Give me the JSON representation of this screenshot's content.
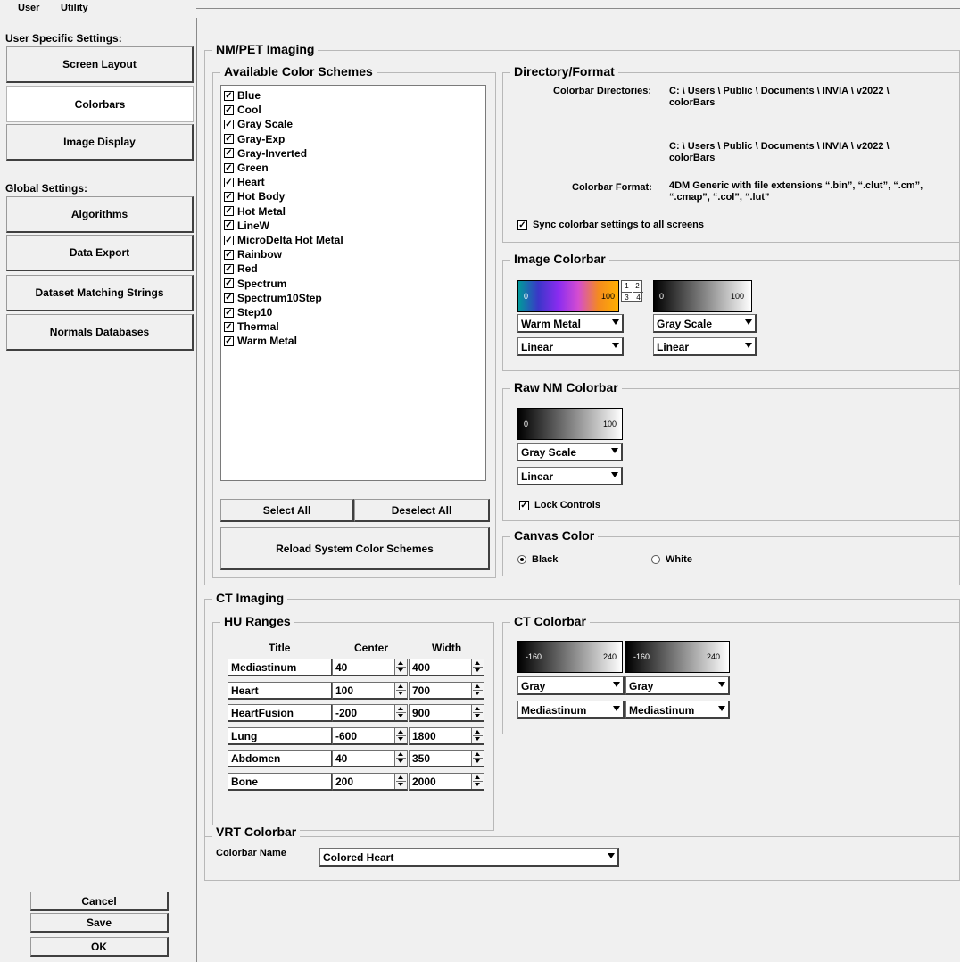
{
  "menu": {
    "user": "User",
    "utility": "Utility"
  },
  "sidebar": {
    "user_section": "User Specific Settings:",
    "global_section": "Global Settings:",
    "screen_layout": "Screen Layout",
    "colorbars": "Colorbars",
    "image_display": "Image Display",
    "algorithms": "Algorithms",
    "data_export": "Data Export",
    "dataset_matching": "Dataset Matching Strings",
    "normals_databases": "Normals Databases",
    "cancel": "Cancel",
    "save": "Save",
    "ok": "OK"
  },
  "nm_pet": {
    "title": "NM/PET Imaging",
    "available_title": "Available Color Schemes",
    "schemes": [
      "Blue",
      "Cool",
      "Gray Scale",
      "Gray-Exp",
      "Gray-Inverted",
      "Green",
      "Heart",
      "Hot Body",
      "Hot Metal",
      "LineW",
      "MicroDelta Hot Metal",
      "Rainbow",
      "Red",
      "Spectrum",
      "Spectrum10Step",
      "Step10",
      "Thermal",
      "Warm Metal"
    ],
    "check_mark": "✓",
    "select_all": "Select All",
    "deselect_all": "Deselect All",
    "reload": "Reload System Color Schemes"
  },
  "directory": {
    "title": "Directory/Format",
    "dirs_label": "Colorbar Directories:",
    "dir1_line1": "C: \\ Users \\ Public \\ Documents \\ INVIA \\ v2022 \\",
    "dir1_line2": "colorBars",
    "dir2_line1": "C: \\ Users \\ Public \\ Documents \\ INVIA \\ v2022 \\",
    "dir2_line2": "colorBars",
    "format_label": "Colorbar Format:",
    "format_line1": "4DM Generic with file extensions “.bin”, “.clut”, “.cm”,",
    "format_line2": "“.cmap”, “.col”, “.lut”",
    "sync_label": "Sync colorbar settings to all screens",
    "sync_checked": true
  },
  "image_colorbar": {
    "title": "Image Colorbar",
    "bar1_min": "0",
    "bar1_max": "100",
    "bar2_min": "0",
    "bar2_max": "100",
    "grid": [
      "1",
      "2",
      "3",
      "4"
    ],
    "scheme1": "Warm Metal",
    "scale1": "Linear",
    "scheme2": "Gray Scale",
    "scale2": "Linear"
  },
  "raw_nm": {
    "title": "Raw NM Colorbar",
    "bar_min": "0",
    "bar_max": "100",
    "scheme": "Gray Scale",
    "scale": "Linear",
    "lock_label": "Lock Controls",
    "lock_checked": true
  },
  "canvas": {
    "title": "Canvas Color",
    "black": "Black",
    "white": "White",
    "selected": "Black"
  },
  "ct": {
    "title": "CT Imaging",
    "hu_title": "HU Ranges",
    "col_title": "Title",
    "col_center": "Center",
    "col_width": "Width",
    "rows": [
      {
        "title": "Mediastinum",
        "center": "40",
        "width": "400"
      },
      {
        "title": "Heart",
        "center": "100",
        "width": "700"
      },
      {
        "title": "HeartFusion",
        "center": "-200",
        "width": "900"
      },
      {
        "title": "Lung",
        "center": "-600",
        "width": "1800"
      },
      {
        "title": "Abdomen",
        "center": "40",
        "width": "350"
      },
      {
        "title": "Bone",
        "center": "200",
        "width": "2000"
      }
    ],
    "colorbar_title": "CT Colorbar",
    "bar1_min": "-160",
    "bar1_max": "240",
    "bar2_min": "-160",
    "bar2_max": "240",
    "scheme1": "Gray",
    "scheme2": "Gray",
    "preset1": "Mediastinum",
    "preset2": "Mediastinum"
  },
  "vrt": {
    "title": "VRT Colorbar",
    "name_label": "Colorbar Name",
    "name_value": "Colored Heart"
  },
  "colors": {
    "warm_metal_gradient": [
      "#009a9a",
      "#3b36c8",
      "#8a2cf0",
      "#d44dd0",
      "#f48a20",
      "#ffb000"
    ],
    "gray_gradient": [
      "#000000",
      "#ffffff"
    ]
  }
}
